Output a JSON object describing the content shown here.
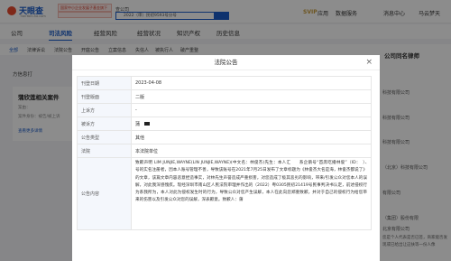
{
  "header": {
    "logo_name": "天眼查",
    "logo_sub": "TianYanCha.com",
    "promo_text": "国家中小企业发展子基金旗下",
    "search_tab": "查公司",
    "search_value": "2022（审）民初9593号分号",
    "nav": [
      "应用",
      "数据服务",
      "消息中心",
      "马云梦天"
    ],
    "svip_label": "SVIP"
  },
  "tabs": [
    "公司",
    "司法风险",
    "经营风险",
    "经营状况",
    "知识产权",
    "历史信息"
  ],
  "active_tab_index": 1,
  "subnav": [
    "全部",
    "法律诉讼",
    "法院公告",
    "开庭公告",
    "立案信息",
    "失信人",
    "被执行人",
    "破产重整"
  ],
  "left": {
    "source_line": "方信息打",
    "card_title": "蒲欣莲相关案件",
    "card_lines": [
      "案由：",
      "案件身份：被告/被上诉"
    ],
    "card_more": "查看更多详情"
  },
  "right_panel": {
    "heading": "公司同名律师",
    "rows": [
      "",
      "科技有限公司",
      "科技有限公司",
      "科技有限公司",
      "（北京）科技有限公司",
      "有限公司",
      "（集团）股份有限",
      "北京有限公司"
    ],
    "note": "您是个人代表是否已签，商家能否发现或已给出让这扶等一份人像"
  },
  "modal": {
    "title": "法院公告",
    "close_glyph": "×",
    "rows": [
      {
        "label": "刊登日期",
        "value": "2023-04-08"
      },
      {
        "label": "刊登版面",
        "value": "二版"
      },
      {
        "label": "上诉方",
        "value": "-"
      },
      {
        "label": "被诉方",
        "value": "蒲"
      },
      {
        "label": "公告类型",
        "value": "其他"
      },
      {
        "label": "法院",
        "value": "本法院单位"
      }
    ],
    "content_label": "公告内容",
    "content": "致歉声明 LIM JUNJIE,WAYNE(LIN JUNJIE,WAYNE)(中文名：林俊杰)先生：本人汇　　系企鹅号“首席吃播林俊”（ID：　）、　号的实名注册者，因本人账号管理不善，导致该账号在2021年7月25日发布了文章标题为《林俊杰大名是海，林俊杰都说了》的文章，该篇文章内容恶意捏造事实，对林先生声誉造成严重损害，对您造成了极其恶劣的影响，带来/引发公众对您本人的误解，对此我深感愧疚。现经深圳市南山区人民法院审理并作出的（2022）粤0305民初21419号民事判决书认定，前述侵权行为系我所为，本人对此为侵权发生时的行为，导致公众对您产生误解，本人在此向您郑重致歉，并对于自己的侵权行为给您带来的伤害以及引发公众对您的误解，深表歉意。致歉人：蒲"
  }
}
